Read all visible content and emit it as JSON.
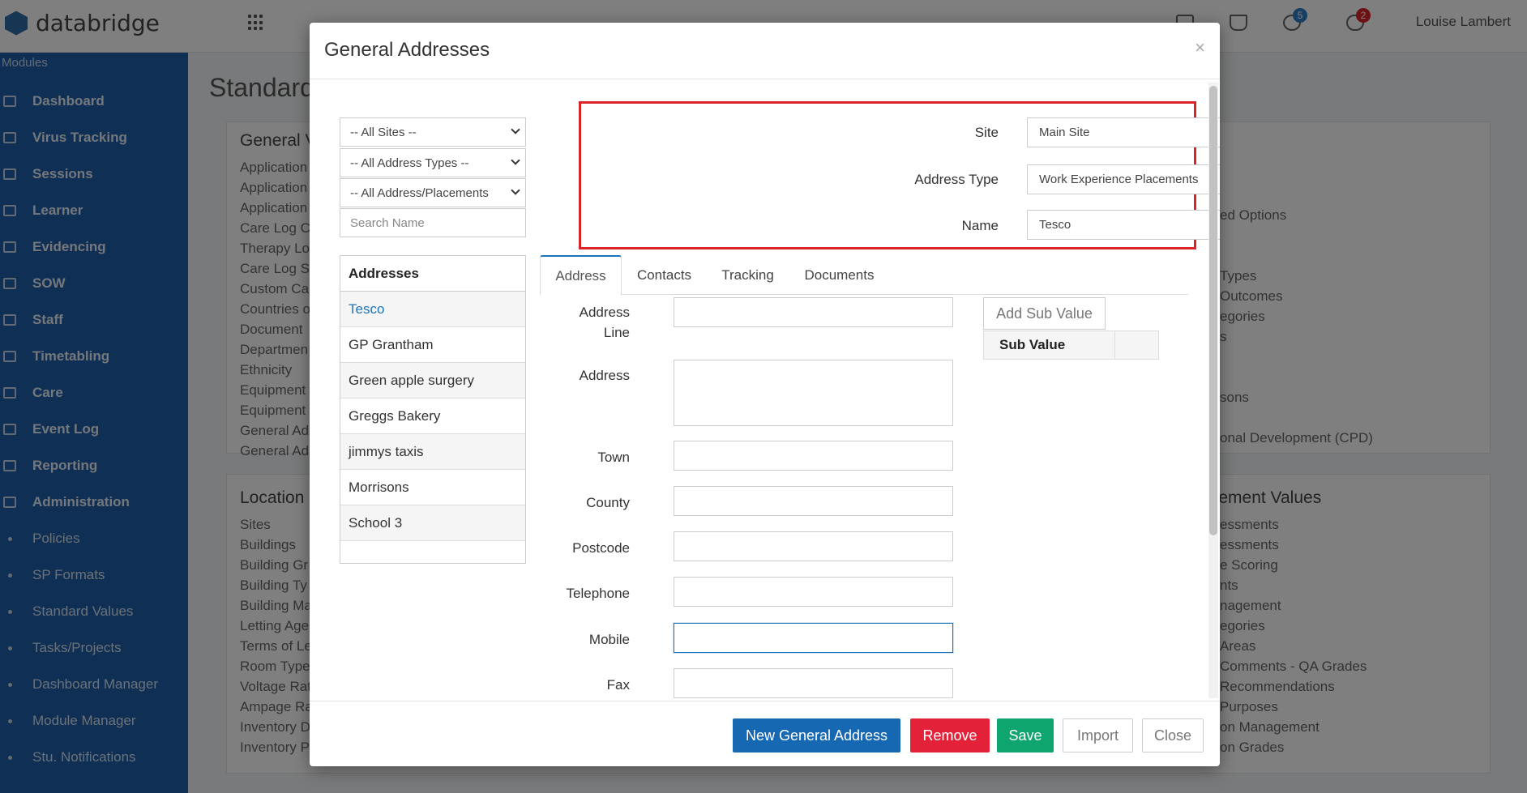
{
  "app": {
    "brand": "databridge",
    "user": "Louise Lambert",
    "badges": {
      "tasks": "5",
      "messages": "2"
    },
    "colors": {
      "sidebar": "#1f5ea8",
      "primary": "#1768b3",
      "danger": "#e3223a",
      "success": "#0ea56e",
      "highlight": "#d9252a"
    }
  },
  "sidebar": {
    "modules_label": "Modules",
    "items": [
      {
        "label": "Dashboard",
        "icon": "chart-icon"
      },
      {
        "label": "Virus Tracking",
        "icon": "pulse-icon"
      },
      {
        "label": "Sessions",
        "icon": "layers-icon"
      },
      {
        "label": "Learner",
        "icon": "user-icon"
      },
      {
        "label": "Evidencing",
        "icon": "camera-icon"
      },
      {
        "label": "SOW",
        "icon": "book-icon"
      },
      {
        "label": "Staff",
        "icon": "user-icon"
      },
      {
        "label": "Timetabling",
        "icon": "calendar-icon"
      },
      {
        "label": "Care",
        "icon": "card-icon"
      },
      {
        "label": "Event Log",
        "icon": "clipboard-icon"
      },
      {
        "label": "Reporting",
        "icon": "bar-chart-icon"
      },
      {
        "label": "Administration",
        "icon": "gear-icon"
      }
    ],
    "subitems": [
      "Policies",
      "SP Formats",
      "Standard Values",
      "Tasks/Projects",
      "Dashboard Manager",
      "Module Manager",
      "Stu. Notifications"
    ]
  },
  "background": {
    "page_title": "Standard",
    "general_heading": "General V",
    "general_lines": [
      "Application",
      "Application",
      "Application",
      "Care Log Ca",
      "Therapy Lo",
      "Care Log St",
      "Custom Ca",
      "Countries o",
      "Document",
      "Departmen",
      "Ethnicity",
      "Equipment",
      "Equipment",
      "General Ad",
      "General Ad"
    ],
    "right_lines_top": [
      "ed Options",
      "Types",
      "Outcomes",
      "egories",
      "s",
      "sons",
      "onal Development (CPD)"
    ],
    "location_heading": "Location",
    "location_lines": [
      "Sites",
      "Buildings",
      "Building Gr",
      "Building Ty",
      "Building Ma",
      "Letting Age",
      "Terms of Le",
      "Room Type",
      "Voltage Rat",
      "Ampage Ra",
      "Inventory D",
      "Inventory P"
    ],
    "right_heading": "agement Values",
    "right_lines_bottom": [
      "essments",
      "essments",
      "e Scoring",
      "nts",
      "nagement",
      "egories",
      "Areas",
      "Comments - QA Grades",
      "Recommendations",
      "Purposes",
      "on Management",
      "on Grades"
    ]
  },
  "modal": {
    "title": "General Addresses",
    "close": "×",
    "filters": {
      "sites": "-- All Sites --",
      "address_types": "-- All Address Types --",
      "placements": "-- All Address/Placements",
      "search_placeholder": "Search Name"
    },
    "list": {
      "header": "Addresses",
      "items": [
        "Tesco",
        "GP Grantham",
        "Green apple surgery",
        "Greggs Bakery",
        "jimmys taxis",
        "Morrisons",
        "School 3"
      ]
    },
    "form": {
      "site_label": "Site",
      "site_value": "Main Site",
      "type_label": "Address Type",
      "type_value": "Work Experience Placements",
      "name_label": "Name",
      "name_value": "Tesco"
    },
    "tabs": [
      "Address",
      "Contacts",
      "Tracking",
      "Documents"
    ],
    "address_fields": {
      "address_line": "Address Line",
      "address": "Address",
      "town": "Town",
      "county": "County",
      "postcode": "Postcode",
      "telephone": "Telephone",
      "mobile": "Mobile",
      "fax": "Fax"
    },
    "sub_value": {
      "button": "Add Sub Value",
      "header": "Sub Value"
    },
    "footer": {
      "new": "New General Address",
      "remove": "Remove",
      "save": "Save",
      "import": "Import",
      "close": "Close"
    }
  }
}
